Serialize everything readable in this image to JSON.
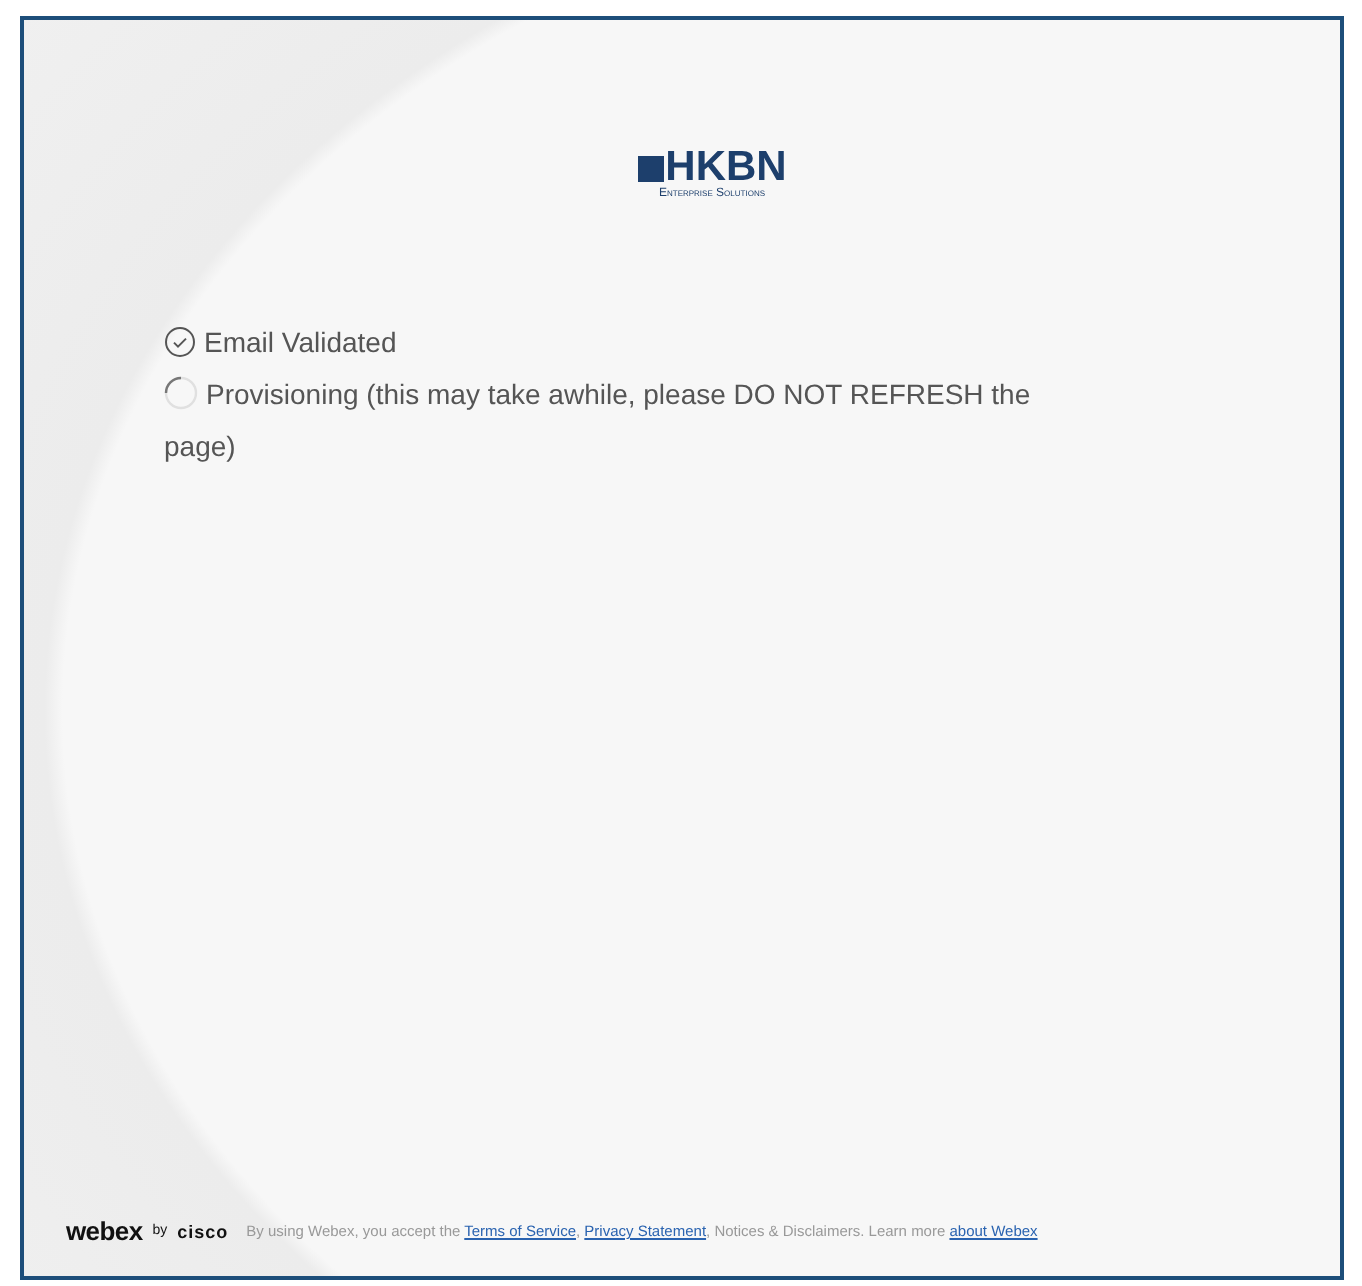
{
  "logo": {
    "name": "HKBN",
    "tagline": "Enterprise Solutions"
  },
  "steps": [
    {
      "kind": "done",
      "label": "Email Validated"
    },
    {
      "kind": "in_progress",
      "label": "Provisioning (this may take awhile, please DO NOT REFRESH the page)"
    }
  ],
  "footer": {
    "brand": "webex",
    "by": "by",
    "maker": "cisco",
    "parts": [
      {
        "kind": "text",
        "text": "By using Webex, you accept the "
      },
      {
        "kind": "link",
        "text": "Terms of Service"
      },
      {
        "kind": "text",
        "text": ", "
      },
      {
        "kind": "link",
        "text": "Privacy Statement"
      },
      {
        "kind": "text",
        "text": ", Notices & Disclaimers. Learn more "
      },
      {
        "kind": "link",
        "text": "about Webex"
      }
    ]
  }
}
